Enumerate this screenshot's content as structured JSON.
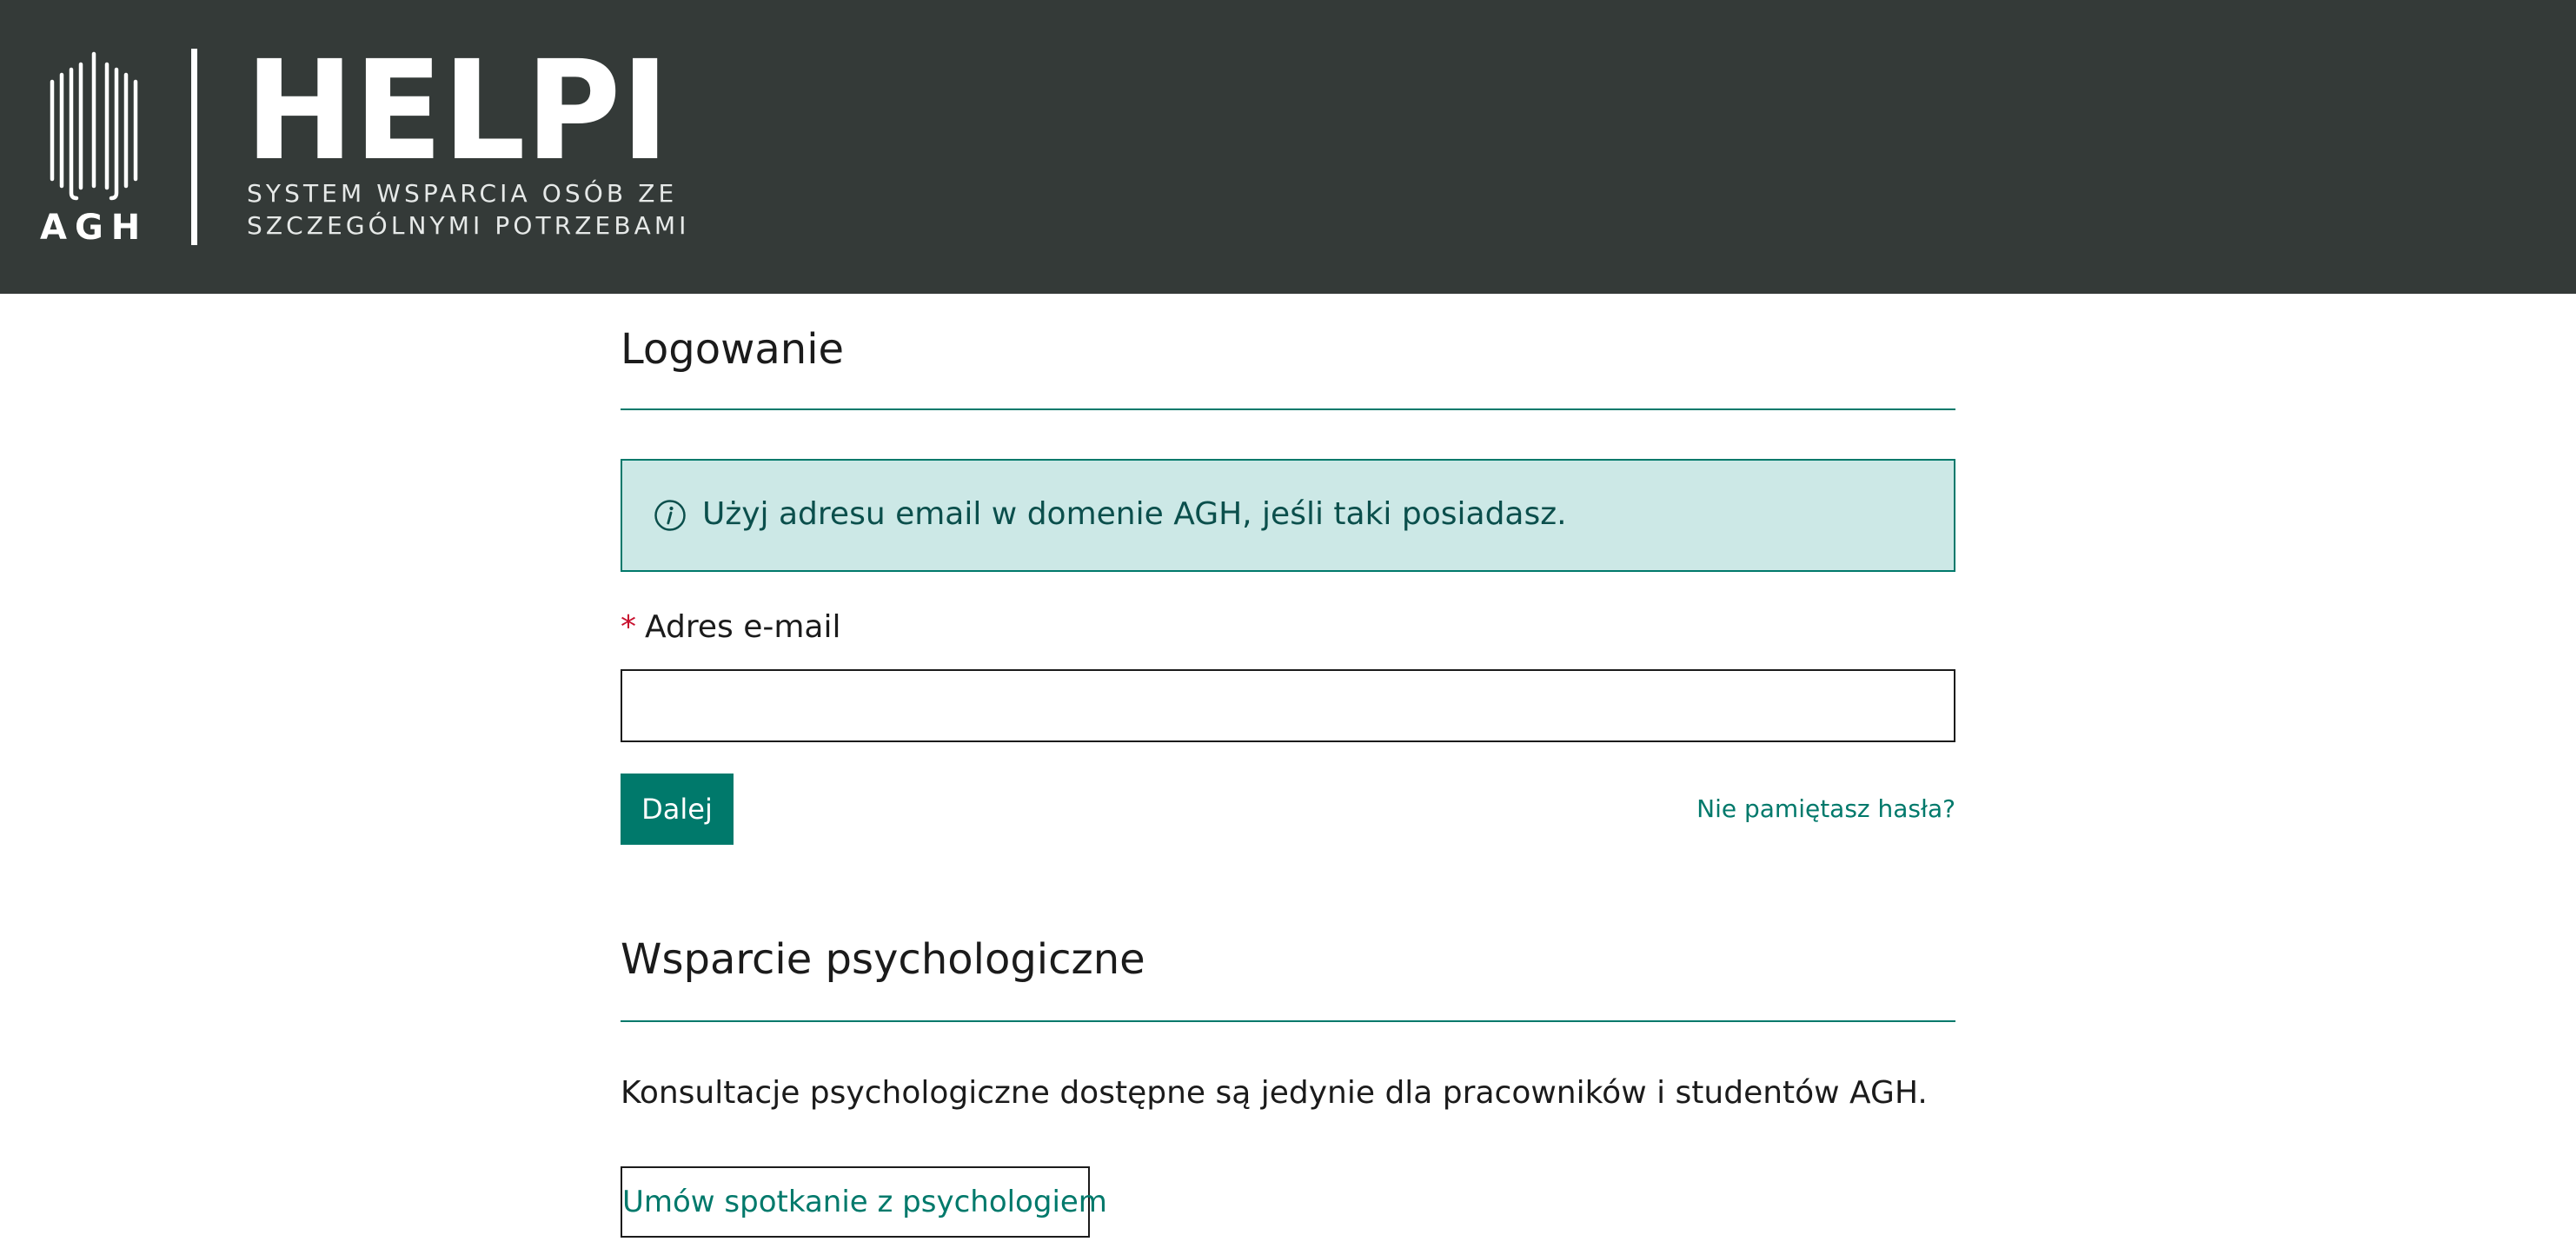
{
  "header": {
    "logo_agh_text": "AGH",
    "logo_helpi_text": "HELPI",
    "subtitle_line1": "SYSTEM WSPARCIA OSÓB ZE",
    "subtitle_line2": "SZCZEGÓLNYMI POTRZEBAMI",
    "background_color": "#343a38"
  },
  "login": {
    "title": "Logowanie",
    "info_message": "Użyj adresu email w domenie AGH, jeśli taki posiadasz.",
    "email_label": "Adres e-mail",
    "required_marker": "*",
    "email_value": "",
    "submit_label": "Dalej",
    "forgot_password_label": "Nie pamiętasz hasła?"
  },
  "support": {
    "title": "Wsparcie psychologiczne",
    "description": "Konsultacje psychologiczne dostępne są jedynie dla pracowników i studentów AGH.",
    "appointment_label": "Umów spotkanie z psychologiem"
  },
  "colors": {
    "accent": "#00796b",
    "info_background": "#cce8e6",
    "info_text": "#0b4f4c",
    "required": "#c8102e"
  },
  "icons": {
    "info": "info-circle-icon",
    "logo": "agh-logo-icon"
  }
}
